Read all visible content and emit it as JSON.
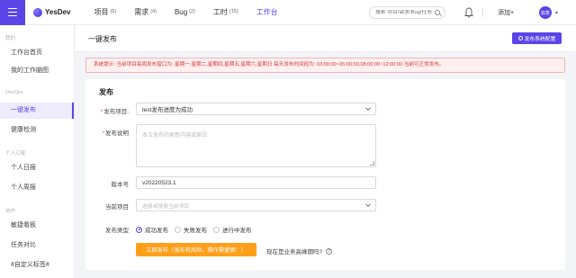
{
  "app": {
    "name": "YesDev"
  },
  "topnav": {
    "items": [
      {
        "label": "项目",
        "count": "(6)"
      },
      {
        "label": "需求",
        "count": "(4)"
      },
      {
        "label": "Bug",
        "count": "(2)"
      },
      {
        "label": "工时",
        "count": "(15)"
      },
      {
        "label": "工作台",
        "count": ""
      }
    ],
    "search_placeholder": "搜索 项目/需求/Bug/任务",
    "add_label": "添加+",
    "avatar_text": "如意"
  },
  "sidebar": {
    "groups": [
      {
        "label": "我的",
        "items": [
          "工作台首页",
          "我的工作脑图"
        ]
      },
      {
        "label": "DevOps",
        "items": [
          "一键发布",
          "健康检测"
        ]
      },
      {
        "label": "个人汇报",
        "items": [
          "个人日报",
          "个人周报"
        ]
      },
      {
        "label": "协作",
        "items": [
          "敏捷看板",
          "任务对比",
          "#自定义标签#"
        ]
      }
    ]
  },
  "page": {
    "title": "一键发布",
    "config_button": "发布系统配置",
    "notice": "系统提示: 当前项目每周发布窗口为: 星期一,星期二,星期四,星期五,星期六,星期日 每天发布时间段为: 03:00:00~05:00:00,08:00:00~12:00:00 当前可正常发布。"
  },
  "form": {
    "section_title": "发布",
    "project_label": "发布项目:",
    "project_value": "test发布进度为成功",
    "desc_label": "发布说明",
    "desc_placeholder": "本次发布的更新内容或原因",
    "version_label": "版本号",
    "version_value": "v20220523.1",
    "current_project_label": "当前项目",
    "current_project_placeholder": "选择或搜索当前项目",
    "type_label": "发布类型",
    "types": [
      "成功发布",
      "失败发布",
      "进行中发布"
    ],
    "selected_type": "成功发布",
    "submit_label": "立即发布（发布有风险，操作需谨慎！）",
    "peak_question": "现在是业务高峰期吗?",
    "question_mark": "?"
  },
  "colors": {
    "accent": "#5b45e8",
    "warning": "#ff9f1a",
    "error": "#d93636"
  }
}
